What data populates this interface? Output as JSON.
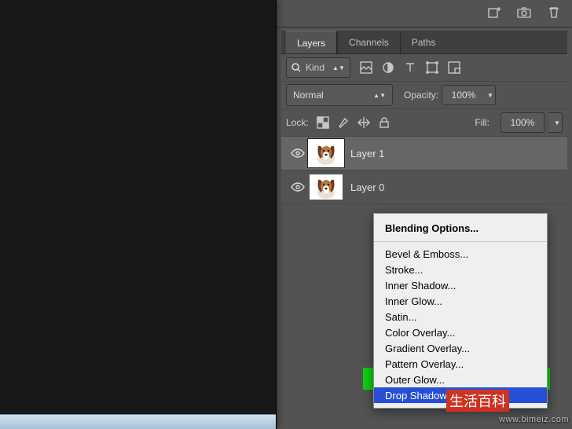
{
  "top_icons": [
    "add-panel-icon",
    "camera-icon",
    "trash-icon"
  ],
  "tabs": {
    "layers": "Layers",
    "channels": "Channels",
    "paths": "Paths"
  },
  "filter": {
    "label": "Kind"
  },
  "blend": {
    "mode": "Normal",
    "opacity_label": "Opacity:",
    "opacity": "100%"
  },
  "lock": {
    "label": "Lock:",
    "fill_label": "Fill:",
    "fill": "100%"
  },
  "layers": [
    {
      "name": "Layer 1",
      "selected": true
    },
    {
      "name": "Layer 0",
      "selected": false
    }
  ],
  "fx": {
    "header": "Blending Options...",
    "items": [
      "Bevel & Emboss...",
      "Stroke...",
      "Inner Shadow...",
      "Inner Glow...",
      "Satin...",
      "Color Overlay...",
      "Gradient Overlay...",
      "Pattern Overlay...",
      "Outer Glow...",
      "Drop Shadow..."
    ]
  },
  "watermark": {
    "logo": "生活百科",
    "url": "www.bimeiz.com"
  }
}
